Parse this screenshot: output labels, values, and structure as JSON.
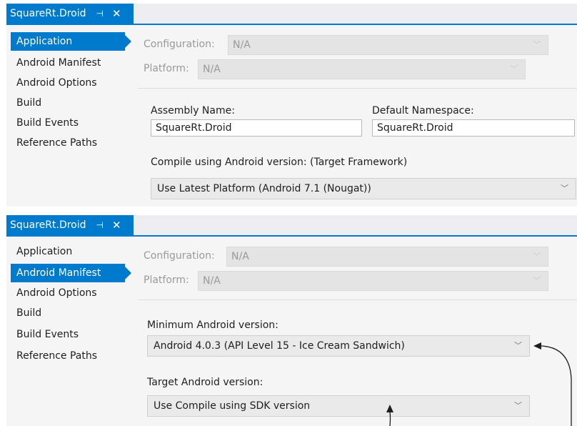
{
  "top_panel": {
    "tab": {
      "title": "SquareRt.Droid",
      "pin_icon": "pin-icon",
      "close_icon": "close-icon"
    },
    "nav": [
      {
        "label": "Application",
        "active": true
      },
      {
        "label": "Android Manifest",
        "active": false
      },
      {
        "label": "Android Options",
        "active": false
      },
      {
        "label": "Build",
        "active": false
      },
      {
        "label": "Build Events",
        "active": false
      },
      {
        "label": "Reference Paths",
        "active": false
      }
    ],
    "configuration": {
      "label": "Configuration:",
      "value": "N/A"
    },
    "platform": {
      "label": "Platform:",
      "value": "N/A"
    },
    "assembly_name": {
      "label": "Assembly Name:",
      "value": "SquareRt.Droid"
    },
    "default_namespace": {
      "label": "Default Namespace:",
      "value": "SquareRt.Droid"
    },
    "compile": {
      "label": "Compile using Android version:  (Target Framework)",
      "value": "Use Latest Platform (Android 7.1 (Nougat))"
    }
  },
  "bottom_panel": {
    "tab": {
      "title": "SquareRt.Droid",
      "pin_icon": "pin-icon",
      "close_icon": "close-icon"
    },
    "nav": [
      {
        "label": "Application",
        "active": false
      },
      {
        "label": "Android Manifest",
        "active": true
      },
      {
        "label": "Android Options",
        "active": false
      },
      {
        "label": "Build",
        "active": false
      },
      {
        "label": "Build Events",
        "active": false
      },
      {
        "label": "Reference Paths",
        "active": false
      }
    ],
    "configuration": {
      "label": "Configuration:",
      "value": "N/A"
    },
    "platform": {
      "label": "Platform:",
      "value": "N/A"
    },
    "minimum_android": {
      "label": "Minimum Android version:",
      "value": "Android 4.0.3 (API Level 15 - Ice Cream Sandwich)"
    },
    "target_android": {
      "label": "Target Android version:",
      "value": "Use Compile using SDK version"
    }
  },
  "colors": {
    "accent": "#007acc",
    "panel_background": "#f5f5f5",
    "disabled_text": "#9a9a9a",
    "annotation_arrow": "#1e1e1e"
  }
}
